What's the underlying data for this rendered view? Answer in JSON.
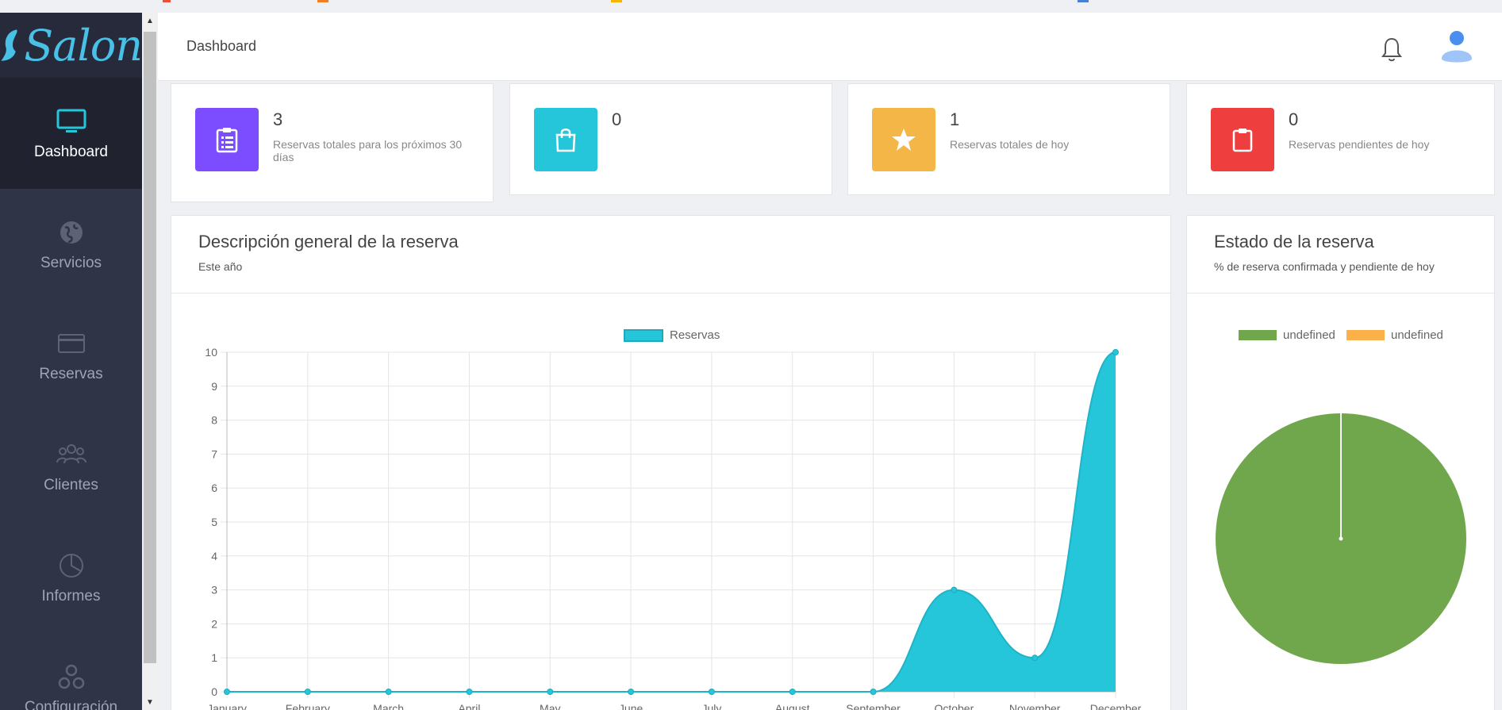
{
  "brand": {
    "logo_text": "Salon",
    "logo_color": "#49c0e6"
  },
  "sidebar": {
    "items": [
      {
        "label": "Dashboard",
        "icon": "monitor-icon",
        "active": true
      },
      {
        "label": "Servicios",
        "icon": "globe-icon"
      },
      {
        "label": "Reservas",
        "icon": "credit-card-icon"
      },
      {
        "label": "Clientes",
        "icon": "users-icon"
      },
      {
        "label": "Informes",
        "icon": "pie-chart-icon"
      },
      {
        "label": "Configuración",
        "icon": "cogs-icon"
      }
    ]
  },
  "header": {
    "title": "Dashboard",
    "bell_icon": "bell-icon",
    "avatar_icon": "user-avatar-icon"
  },
  "stats": [
    {
      "value": "3",
      "label": "Reservas totales para los próximos 30 días",
      "color": "#7c4dff",
      "icon": "clipboard-list-icon"
    },
    {
      "value": "0",
      "label": "",
      "color": "#26c6da",
      "icon": "shopping-bag-icon"
    },
    {
      "value": "1",
      "label": "Reservas totales de hoy",
      "color": "#f4b647",
      "icon": "star-icon"
    },
    {
      "value": "0",
      "label": "Reservas pendientes de hoy",
      "color": "#ef3e3e",
      "icon": "clipboard-icon"
    }
  ],
  "overview": {
    "title": "Descripción general de la reserva",
    "subtitle": "Este año"
  },
  "status": {
    "title": "Estado de la reserva",
    "subtitle": "% de reserva confirmada y pendiente de hoy"
  },
  "chart_data": [
    {
      "type": "area",
      "categories": [
        "January",
        "February",
        "March",
        "April",
        "May",
        "June",
        "July",
        "August",
        "September",
        "October",
        "November",
        "December"
      ],
      "series": [
        {
          "name": "Reservas",
          "values": [
            0,
            0,
            0,
            0,
            0,
            0,
            0,
            0,
            0,
            3,
            1,
            10
          ],
          "color": "#26c6da"
        }
      ],
      "ylim": [
        0,
        10
      ],
      "yticks": [
        0,
        1,
        2,
        3,
        4,
        5,
        6,
        7,
        8,
        9,
        10
      ],
      "grid": true,
      "legend": "top"
    },
    {
      "type": "pie",
      "labels": [
        "undefined",
        "undefined"
      ],
      "values": [
        100,
        0
      ],
      "colors": [
        "#71a74c",
        "#fbb04a"
      ],
      "legend": "top"
    }
  ]
}
